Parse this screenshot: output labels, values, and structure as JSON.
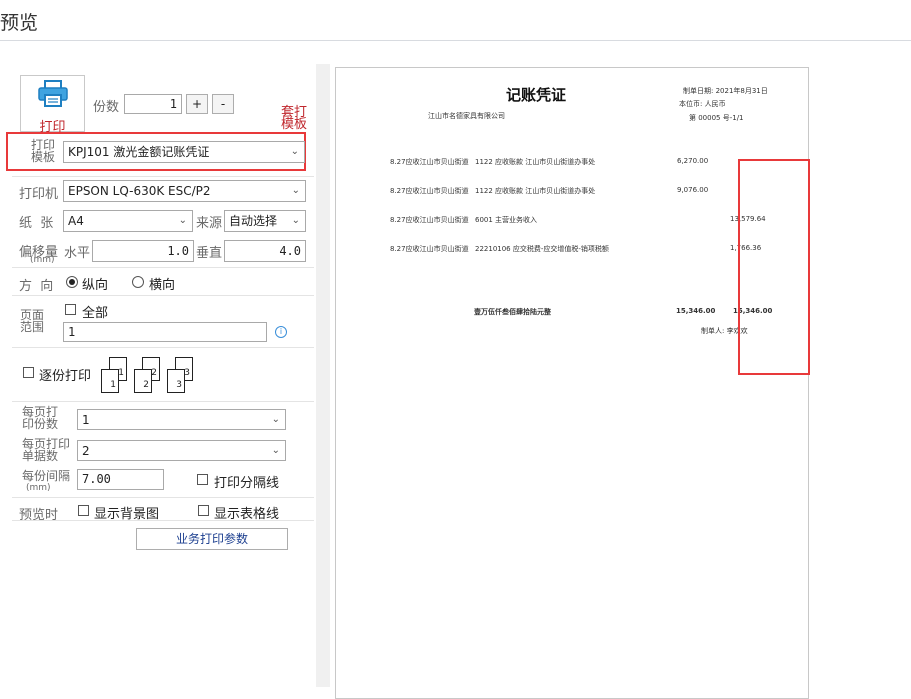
{
  "window": {
    "title": "预览"
  },
  "print": {
    "print_label": "打印",
    "copies_label": "份数",
    "copies_value": "1",
    "plus": "+",
    "minus": "-",
    "overlay_label_1": "套打",
    "overlay_label_2": "模板"
  },
  "template": {
    "label_1": "打印",
    "label_2": "模板",
    "value": "KPJ101 激光金额记账凭证"
  },
  "printer": {
    "label": "打印机",
    "value": "EPSON LQ-630K ESC/P2"
  },
  "paper": {
    "label": "纸  张",
    "value": "A4",
    "source_label": "来源",
    "source_value": "自动选择"
  },
  "offset": {
    "label": "偏移量",
    "unit": "(mm)",
    "h_label": "水平",
    "h_value": "1.0",
    "v_label": "垂直",
    "v_value": "4.0"
  },
  "orientation": {
    "label": "方  向",
    "portrait": "纵向",
    "landscape": "横向",
    "selected": "portrait"
  },
  "page_range": {
    "label_1": "页面",
    "label_2": "范围",
    "all_label": "全部",
    "value": "1",
    "info_icon": "info-icon"
  },
  "collate": {
    "label": "逐份打印",
    "docs": [
      "1",
      "2",
      "3"
    ]
  },
  "per_page_copies": {
    "label_1": "每页打",
    "label_2": "印份数",
    "value": "1"
  },
  "per_page_docs": {
    "label_1": "每页打印",
    "label_2": "单据数",
    "value": "2"
  },
  "gap": {
    "label_1": "每份间隔",
    "label_2": "(mm)",
    "value": "7.00",
    "separator_label": "打印分隔线"
  },
  "preview_opts": {
    "label": "预览时",
    "bg_label": "显示背景图",
    "grid_label": "显示表格线"
  },
  "business_button": "业务打印参数",
  "voucher": {
    "title": "记账凭证",
    "company": "江山市名德家具有限公司",
    "date_line": "制单日期: 2021年8月31日",
    "currency_line": "本位币: 人民币",
    "number_line": "第  00005 号-1/1",
    "rows": [
      {
        "summary": "8.27应收江山市贝山街道",
        "account": "1122 应收账款 江山市贝山街道办事处",
        "debit": "6,270.00",
        "credit": ""
      },
      {
        "summary": "8.27应收江山市贝山街道",
        "account": "1122 应收账款 江山市贝山街道办事处",
        "debit": "9,076.00",
        "credit": ""
      },
      {
        "summary": "8.27应收江山市贝山街道",
        "account": "6001 主营业务收入",
        "debit": "",
        "credit": "13,579.64"
      },
      {
        "summary": "8.27应收江山市贝山街道",
        "account": "22210106 应交税费-应交增值税-销项税额",
        "debit": "",
        "credit": "1,766.36"
      }
    ],
    "total_words": "壹万伍仟叁佰肆拾陆元整",
    "total_debit": "15,346.00",
    "total_credit": "15,346.00",
    "maker": "制单人: 李欢欢"
  }
}
